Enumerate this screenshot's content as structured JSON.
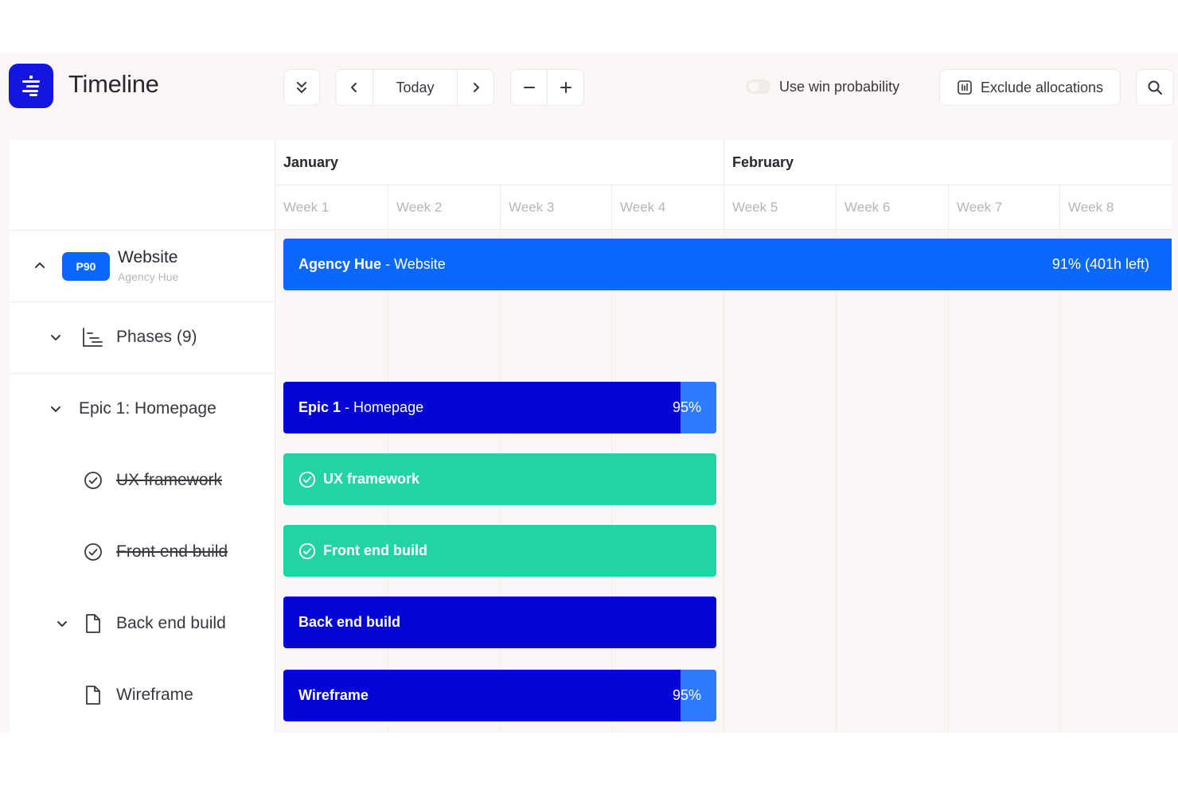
{
  "header": {
    "title": "Timeline",
    "today_label": "Today",
    "win_probability_label": "Use win probability",
    "win_probability_on": false,
    "exclude_label": "Exclude allocations"
  },
  "months": [
    {
      "label": "January"
    },
    {
      "label": "February"
    }
  ],
  "weeks": [
    "Week 1",
    "Week 2",
    "Week 3",
    "Week 4",
    "Week 5",
    "Week 6",
    "Week 7",
    "Week 8"
  ],
  "project": {
    "badge": "P90",
    "name": "Website",
    "client": "Agency Hue"
  },
  "tree": {
    "phases": "Phases (9)",
    "epic": "Epic 1: Homepage",
    "task1": "UX framework",
    "task2": "Front end build",
    "task3": "Back end build",
    "task4": "Wireframe"
  },
  "bars": {
    "project": {
      "bold": "Agency Hue",
      "sep": " - ",
      "rest": "Website",
      "right": "91% (401h left)"
    },
    "epic": {
      "bold": "Epic 1",
      "sep": " - ",
      "rest": "Homepage",
      "pct": "95%",
      "progress": 0.95
    },
    "ux": {
      "label": "UX framework",
      "done": true
    },
    "frontend": {
      "label": "Front end build",
      "done": true
    },
    "backend": {
      "label": "Back end build"
    },
    "wireframe": {
      "label": "Wireframe",
      "pct": "95%",
      "progress": 0.95
    }
  },
  "colors": {
    "accent": "#0a68ff",
    "navy": "#0505d6",
    "done": "#22d3a5",
    "logo": "#1515e0"
  }
}
